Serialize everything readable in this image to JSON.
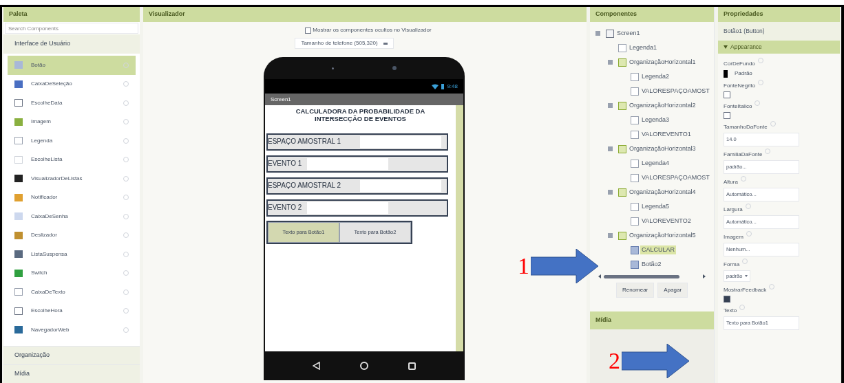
{
  "palette": {
    "title": "Paleta",
    "search": {
      "placeholder": "Search Components"
    },
    "category": "Interface de Usuário",
    "items": [
      {
        "label": "Botão",
        "kind": "button",
        "selected": true
      },
      {
        "label": "CaixaDeSeleção",
        "kind": "checkbox",
        "selected": false
      },
      {
        "label": "EscolheData",
        "kind": "calendar",
        "selected": false
      },
      {
        "label": "Imagem",
        "kind": "image",
        "selected": false
      },
      {
        "label": "Legenda",
        "kind": "label",
        "selected": false
      },
      {
        "label": "EscolheLista",
        "kind": "list",
        "selected": false
      },
      {
        "label": "VisualizadorDeListas",
        "kind": "lines",
        "selected": false
      },
      {
        "label": "Notificador",
        "kind": "warning",
        "selected": false
      },
      {
        "label": "CaixaDeSenha",
        "kind": "password",
        "selected": false
      },
      {
        "label": "Deslizador",
        "kind": "slider",
        "selected": false
      },
      {
        "label": "ListaSuspensa",
        "kind": "dropdown",
        "selected": false
      },
      {
        "label": "Switch",
        "kind": "switch",
        "selected": false
      },
      {
        "label": "CaixaDeTexto",
        "kind": "textbox",
        "selected": false
      },
      {
        "label": "EscolheHora",
        "kind": "clock",
        "selected": false
      },
      {
        "label": "NavegadorWeb",
        "kind": "globe",
        "selected": false
      }
    ],
    "sections": [
      "Organização",
      "Mídia"
    ]
  },
  "viewer": {
    "title": "Visualizador",
    "show_hidden": {
      "label": "Mostrar os componentes ocultos no Visualizador",
      "checked": false
    },
    "size_select": "Tamanho de telefone (505,320)",
    "phone": {
      "time": "9:48",
      "screen_title": "Screen1",
      "heading": "CALCULADORA DA PROBABILIDADE DA INTERSECÇÃO DE EVENTOS",
      "rows": [
        {
          "label": "ESPAÇO AMOSTRAL 1"
        },
        {
          "label": "EVENTO 1"
        },
        {
          "label": "ESPAÇO AMOSTRAL 2"
        },
        {
          "label": "EVENTO 2"
        }
      ],
      "buttons": [
        {
          "label": "Texto para Botão1",
          "selected": true
        },
        {
          "label": "Texto para Botão2",
          "selected": false
        }
      ]
    }
  },
  "components": {
    "title": "Componentes",
    "tree": [
      {
        "label": "Screen1",
        "kind": "screen",
        "selected": false,
        "children": [
          {
            "label": "Legenda1",
            "kind": "label",
            "selected": false
          },
          {
            "label": "OrganizaçãoHorizontal1",
            "kind": "arrangement",
            "selected": false,
            "children": [
              {
                "label": "Legenda2",
                "kind": "label",
                "selected": false
              },
              {
                "label": "VALORESPAÇOAMOST",
                "kind": "textbox",
                "selected": false
              }
            ]
          },
          {
            "label": "OrganizaçãoHorizontal2",
            "kind": "arrangement",
            "selected": false,
            "children": [
              {
                "label": "Legenda3",
                "kind": "label",
                "selected": false
              },
              {
                "label": "VALOREVENTO1",
                "kind": "textbox",
                "selected": false
              }
            ]
          },
          {
            "label": "OrganizaçãoHorizontal3",
            "kind": "arrangement",
            "selected": false,
            "children": [
              {
                "label": "Legenda4",
                "kind": "label",
                "selected": false
              },
              {
                "label": "VALORESPAÇOAMOST",
                "kind": "textbox",
                "selected": false
              }
            ]
          },
          {
            "label": "OrganizaçãoHorizontal4",
            "kind": "arrangement",
            "selected": false,
            "children": [
              {
                "label": "Legenda5",
                "kind": "label",
                "selected": false
              },
              {
                "label": "VALOREVENTO2",
                "kind": "textbox",
                "selected": false
              }
            ]
          },
          {
            "label": "OrganizaçãoHorizontal5",
            "kind": "arrangement",
            "selected": false,
            "children": [
              {
                "label": "CALCULAR",
                "kind": "button",
                "selected": true
              },
              {
                "label": "Botão2",
                "kind": "button",
                "selected": false
              }
            ]
          }
        ]
      }
    ],
    "buttons": [
      "Renomear",
      "Apagar"
    ],
    "media_title": "Mídia"
  },
  "properties": {
    "title": "Propriedades",
    "component": "Botão1 (Button)",
    "group": "Appearance",
    "items": [
      {
        "kind": "color",
        "label": "CorDeFundo",
        "value": "Padrão",
        "color": "#000000"
      },
      {
        "kind": "checkbox",
        "label": "FonteNegrito",
        "checked": false
      },
      {
        "kind": "checkbox",
        "label": "FonteItalico",
        "checked": false
      },
      {
        "kind": "text",
        "label": "TamanhoDaFonte",
        "value": "14.0"
      },
      {
        "kind": "text",
        "label": "FamiliaDaFonte",
        "value": "padrão..."
      },
      {
        "kind": "text",
        "label": "Altura",
        "value": "Automático..."
      },
      {
        "kind": "text",
        "label": "Largura",
        "value": "Automático..."
      },
      {
        "kind": "text",
        "label": "Imagem",
        "value": "Nenhum..."
      },
      {
        "kind": "select",
        "label": "Forma",
        "value": "padrão"
      },
      {
        "kind": "checkbox",
        "label": "MostrarFeedback",
        "checked": true
      },
      {
        "kind": "text",
        "label": "Texto",
        "value": "Texto para Botão1"
      }
    ]
  },
  "annotations": [
    {
      "label": "1"
    },
    {
      "label": "2"
    }
  ]
}
